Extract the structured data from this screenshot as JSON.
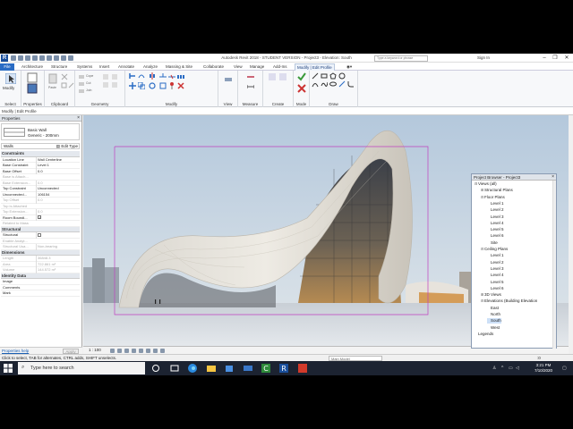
{
  "window": {
    "title": "Autodesk Revit 2018 - STUDENT VERSION -    Project3 - Elevation: South",
    "search_placeholder": "Type a keyword or phrase",
    "signin": "Sign In",
    "app_letter": "R"
  },
  "ribbon_tabs": [
    "File",
    "Architecture",
    "Structure",
    "Systems",
    "Insert",
    "Annotate",
    "Analyze",
    "Massing & Site",
    "Collaborate",
    "View",
    "Manage",
    "Add-Ins",
    "Modify | Edit Profile"
  ],
  "ribbon": {
    "modify_label": "Modify",
    "cope_label": "Cope",
    "cut_label": "Cut",
    "join_label": "Join",
    "paste_label": "Paste",
    "panels": [
      "Select",
      "Properties",
      "Clipboard",
      "Geometry",
      "Modify",
      "View",
      "Measure",
      "Create",
      "Mode",
      "Draw"
    ]
  },
  "options_bar": "Modify | Edit Profile",
  "properties": {
    "title": "Properties",
    "type_line1": "Basic Wall",
    "type_line2": "Generic - 200mm",
    "category": "Walls",
    "edit_type": "Edit Type",
    "groups": [
      {
        "name": "Constraints",
        "rows": [
          {
            "name": "Location Line",
            "value": "Wall Centerline",
            "dim": false
          },
          {
            "name": "Base Constraint",
            "value": "Level 1",
            "dim": false
          },
          {
            "name": "Base Offset",
            "value": "0.0",
            "dim": false
          },
          {
            "name": "Base is Attach...",
            "value": "",
            "dim": true
          },
          {
            "name": "Base Extension...",
            "value": "0.0",
            "dim": true
          },
          {
            "name": "Top Constraint",
            "value": "Unconnected",
            "dim": false
          },
          {
            "name": "Unconnected...",
            "value": "106154",
            "dim": false
          },
          {
            "name": "Top Offset",
            "value": "0.0",
            "dim": true
          },
          {
            "name": "Top is Attached",
            "value": "",
            "dim": true
          },
          {
            "name": "Top Extension...",
            "value": "0.0",
            "dim": true
          },
          {
            "name": "Room Boundi...",
            "value": "check",
            "dim": false
          },
          {
            "name": "Related to Mass",
            "value": "",
            "dim": true
          }
        ]
      },
      {
        "name": "Structural",
        "rows": [
          {
            "name": "Structural",
            "value": "box",
            "dim": false
          },
          {
            "name": "Enable Analyt...",
            "value": "",
            "dim": true
          },
          {
            "name": "Structural Usa...",
            "value": "Non-bearing",
            "dim": true
          }
        ]
      },
      {
        "name": "Dimensions",
        "rows": [
          {
            "name": "Length",
            "value": "36848.3",
            "dim": true
          },
          {
            "name": "Area",
            "value": "722.861 m²",
            "dim": true
          },
          {
            "name": "Volume",
            "value": "144.572 m³",
            "dim": true
          }
        ]
      },
      {
        "name": "Identity Data",
        "rows": [
          {
            "name": "Image",
            "value": "",
            "dim": false
          },
          {
            "name": "Comments",
            "value": "",
            "dim": false
          },
          {
            "name": "Mark",
            "value": "",
            "dim": false
          }
        ]
      }
    ],
    "help_link": "Properties help",
    "apply": "Apply"
  },
  "view_control": {
    "scale": "1 : 100"
  },
  "project_browser": {
    "title": "Project Browser - Project3",
    "items": [
      {
        "label": "Views (all)",
        "level": 0,
        "toggle": "⊟",
        "selected": false
      },
      {
        "label": "Structural Plans",
        "level": 1,
        "toggle": "⊞",
        "selected": false
      },
      {
        "label": "Floor Plans",
        "level": 1,
        "toggle": "⊟",
        "selected": false
      },
      {
        "label": "Level 1",
        "level": 2,
        "toggle": "",
        "selected": false
      },
      {
        "label": "Level 2",
        "level": 2,
        "toggle": "",
        "selected": false
      },
      {
        "label": "Level 3",
        "level": 2,
        "toggle": "",
        "selected": false
      },
      {
        "label": "Level 4",
        "level": 2,
        "toggle": "",
        "selected": false
      },
      {
        "label": "Level 5",
        "level": 2,
        "toggle": "",
        "selected": false
      },
      {
        "label": "Level 6",
        "level": 2,
        "toggle": "",
        "selected": false
      },
      {
        "label": "Site",
        "level": 2,
        "toggle": "",
        "selected": false
      },
      {
        "label": "Ceiling Plans",
        "level": 1,
        "toggle": "⊟",
        "selected": false
      },
      {
        "label": "Level 1",
        "level": 2,
        "toggle": "",
        "selected": false
      },
      {
        "label": "Level 2",
        "level": 2,
        "toggle": "",
        "selected": false
      },
      {
        "label": "Level 3",
        "level": 2,
        "toggle": "",
        "selected": false
      },
      {
        "label": "Level 4",
        "level": 2,
        "toggle": "",
        "selected": false
      },
      {
        "label": "Level 5",
        "level": 2,
        "toggle": "",
        "selected": false
      },
      {
        "label": "Level 6",
        "level": 2,
        "toggle": "",
        "selected": false
      },
      {
        "label": "3D Views",
        "level": 1,
        "toggle": "⊞",
        "selected": false
      },
      {
        "label": "Elevations (Building Elevation",
        "level": 1,
        "toggle": "⊟",
        "selected": false
      },
      {
        "label": "East",
        "level": 2,
        "toggle": "",
        "selected": false
      },
      {
        "label": "North",
        "level": 2,
        "toggle": "",
        "selected": false
      },
      {
        "label": "South",
        "level": 2,
        "toggle": "",
        "selected": true
      },
      {
        "label": "West",
        "level": 2,
        "toggle": "",
        "selected": false
      },
      {
        "label": "Legends",
        "level": 0,
        "toggle": "",
        "selected": false
      }
    ]
  },
  "status_bar": {
    "message": "Click to select, TAB for alternates, CTRL adds, SHIFT unselects.",
    "model": "Main Model",
    "filter": ":0"
  },
  "taskbar": {
    "search_placeholder": "Type here to search",
    "time": "3:21 PM",
    "date": "7/10/2020"
  },
  "colors": {
    "accent": "#2a6cc4",
    "taskbar": "#1c2331",
    "profile_line": "#c040c0"
  }
}
